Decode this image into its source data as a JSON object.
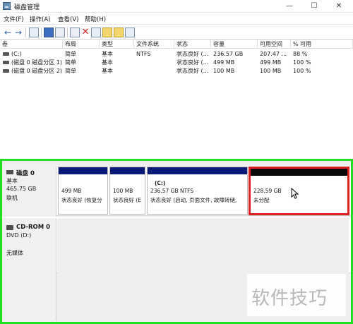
{
  "window": {
    "title": "磁盘管理",
    "controls": {
      "minimize": "—",
      "maximize": "☐",
      "close": "✕"
    }
  },
  "menu": [
    {
      "label": "文件(F)"
    },
    {
      "label": "操作(A)"
    },
    {
      "label": "查看(V)"
    },
    {
      "label": "帮助(H)"
    }
  ],
  "toolbar": {
    "back_icon": "back-arrow-icon",
    "forward_icon": "forward-arrow-icon",
    "arrows": {
      "back": "←",
      "forward": "→"
    },
    "delete_glyph": "✕",
    "colors": {
      "delete": "#d32020",
      "accent": "#2a5c9e"
    }
  },
  "volume_table": {
    "headers": [
      "卷",
      "布局",
      "类型",
      "文件系统",
      "状态",
      "容量",
      "可用空间",
      "% 可用"
    ],
    "rows": [
      [
        "(C:)",
        "简单",
        "基本",
        "NTFS",
        "状态良好 (...",
        "236.57 GB",
        "207.47 ...",
        "88 %"
      ],
      [
        "(磁盘 0 磁盘分区 1)",
        "简单",
        "基本",
        "",
        "状态良好 (...",
        "499 MB",
        "499 MB",
        "100 %"
      ],
      [
        "(磁盘 0 磁盘分区 2)",
        "简单",
        "基本",
        "",
        "状态良好 (...",
        "100 MB",
        "100 MB",
        "100 %"
      ]
    ]
  },
  "disks": [
    {
      "name": "磁盘 0",
      "type": "基本",
      "size": "465.75 GB",
      "status": "联机",
      "partitions": [
        {
          "title": "",
          "size": "499 MB",
          "status": "状态良好 (恢复分",
          "kind": "primary"
        },
        {
          "title": "",
          "size": "100 MB",
          "status": "状态良好 (E",
          "kind": "primary"
        },
        {
          "title": "(C:)",
          "size": "236.57 GB NTFS",
          "status": "状态良好 (启动, 页面文件, 故障转储,",
          "kind": "primary"
        },
        {
          "title": "",
          "size": "228.59 GB",
          "status": "未分配",
          "kind": "unallocated"
        }
      ]
    },
    {
      "name": "CD-ROM 0",
      "type": "DVD (D:)",
      "size": "",
      "status": "无媒体"
    }
  ],
  "highlight_colors": {
    "frame": "#1ee01e",
    "unallocated_box": "#e02020",
    "primary_bar": "#0a1a78",
    "unallocated_bar": "#0a0a0a"
  },
  "watermark": "软件技巧"
}
